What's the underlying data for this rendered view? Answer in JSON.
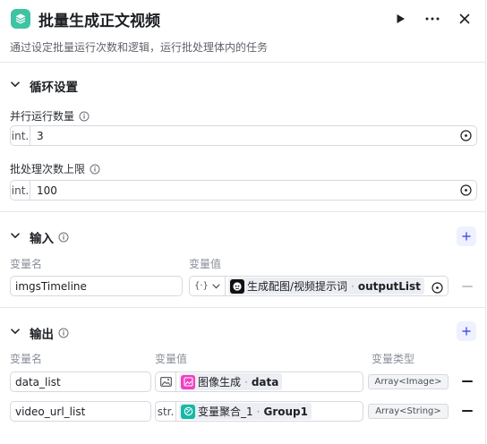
{
  "header": {
    "title": "批量生成正文视频",
    "description": "通过设定批量运行次数和逻辑，运行批处理体内的任务",
    "node_icon": "layers-icon",
    "actions": [
      "play-icon",
      "more-icon",
      "close-icon"
    ]
  },
  "loop_settings": {
    "title": "循环设置",
    "parallel": {
      "label": "并行运行数量",
      "type": "int.",
      "value": "3"
    },
    "batch_limit": {
      "label": "批处理次数上限",
      "type": "int.",
      "value": "100"
    }
  },
  "inputs": {
    "title": "输入",
    "col_name": "变量名",
    "col_value": "变量值",
    "rows": [
      {
        "name": "imgsTimeline",
        "type_glyph": "{·}",
        "source_node": "生成配图/视频提示词",
        "source_field": "outputList"
      }
    ]
  },
  "outputs": {
    "title": "输出",
    "col_name": "变量名",
    "col_value": "变量值",
    "col_type": "变量类型",
    "rows": [
      {
        "name": "data_list",
        "source_node": "图像生成",
        "source_field": "data",
        "var_type": "Array<Image>"
      },
      {
        "name": "video_url_list",
        "prefix": "str.",
        "source_node": "变量聚合_1",
        "source_field": "Group1",
        "var_type": "Array<String>"
      }
    ]
  },
  "colors": {
    "accent": "#4d53e8",
    "node_green": "#3ec3a3",
    "image_pink": "#f23ec3",
    "aggregate_teal": "#18b7a6"
  }
}
